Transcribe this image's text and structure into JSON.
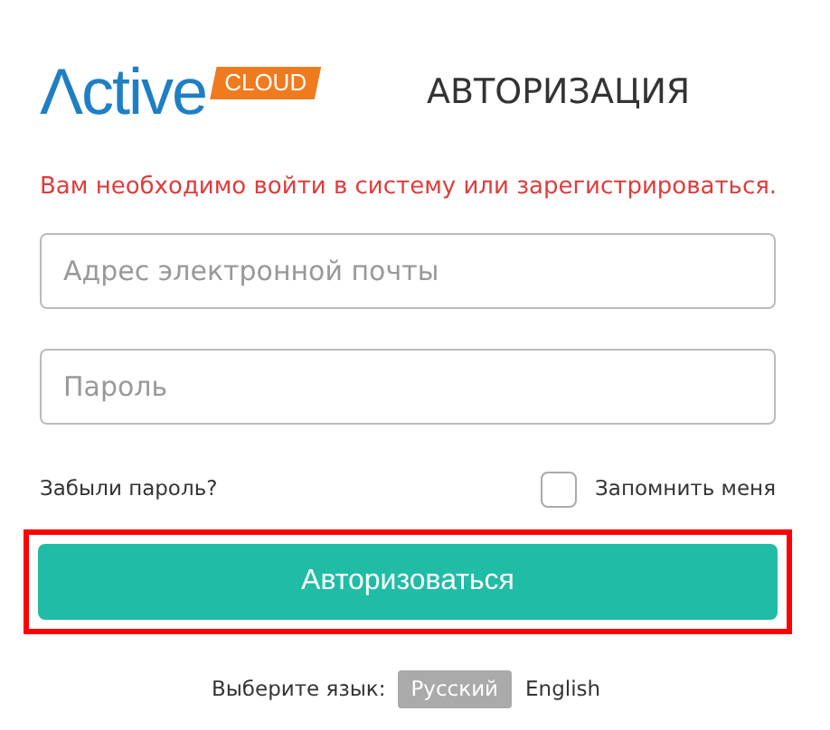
{
  "logo": {
    "word": "Λctive",
    "badge": "CLOUD"
  },
  "title": "АВТОРИЗАЦИЯ",
  "message": "Вам необходимо войти в систему или зарегистрироваться.",
  "fields": [
    {
      "placeholder": "Адрес электронной почты"
    },
    {
      "placeholder": "Пароль"
    }
  ],
  "forgot_link": "Забыли пароль?",
  "remember": {
    "label": "Запомнить меня",
    "checked": false
  },
  "submit": {
    "label": "Авторизоваться",
    "highlighted": true
  },
  "language": {
    "label": "Выберите язык:",
    "options": [
      {
        "label": "Русский",
        "selected": true
      },
      {
        "label": "English",
        "selected": false
      }
    ]
  }
}
